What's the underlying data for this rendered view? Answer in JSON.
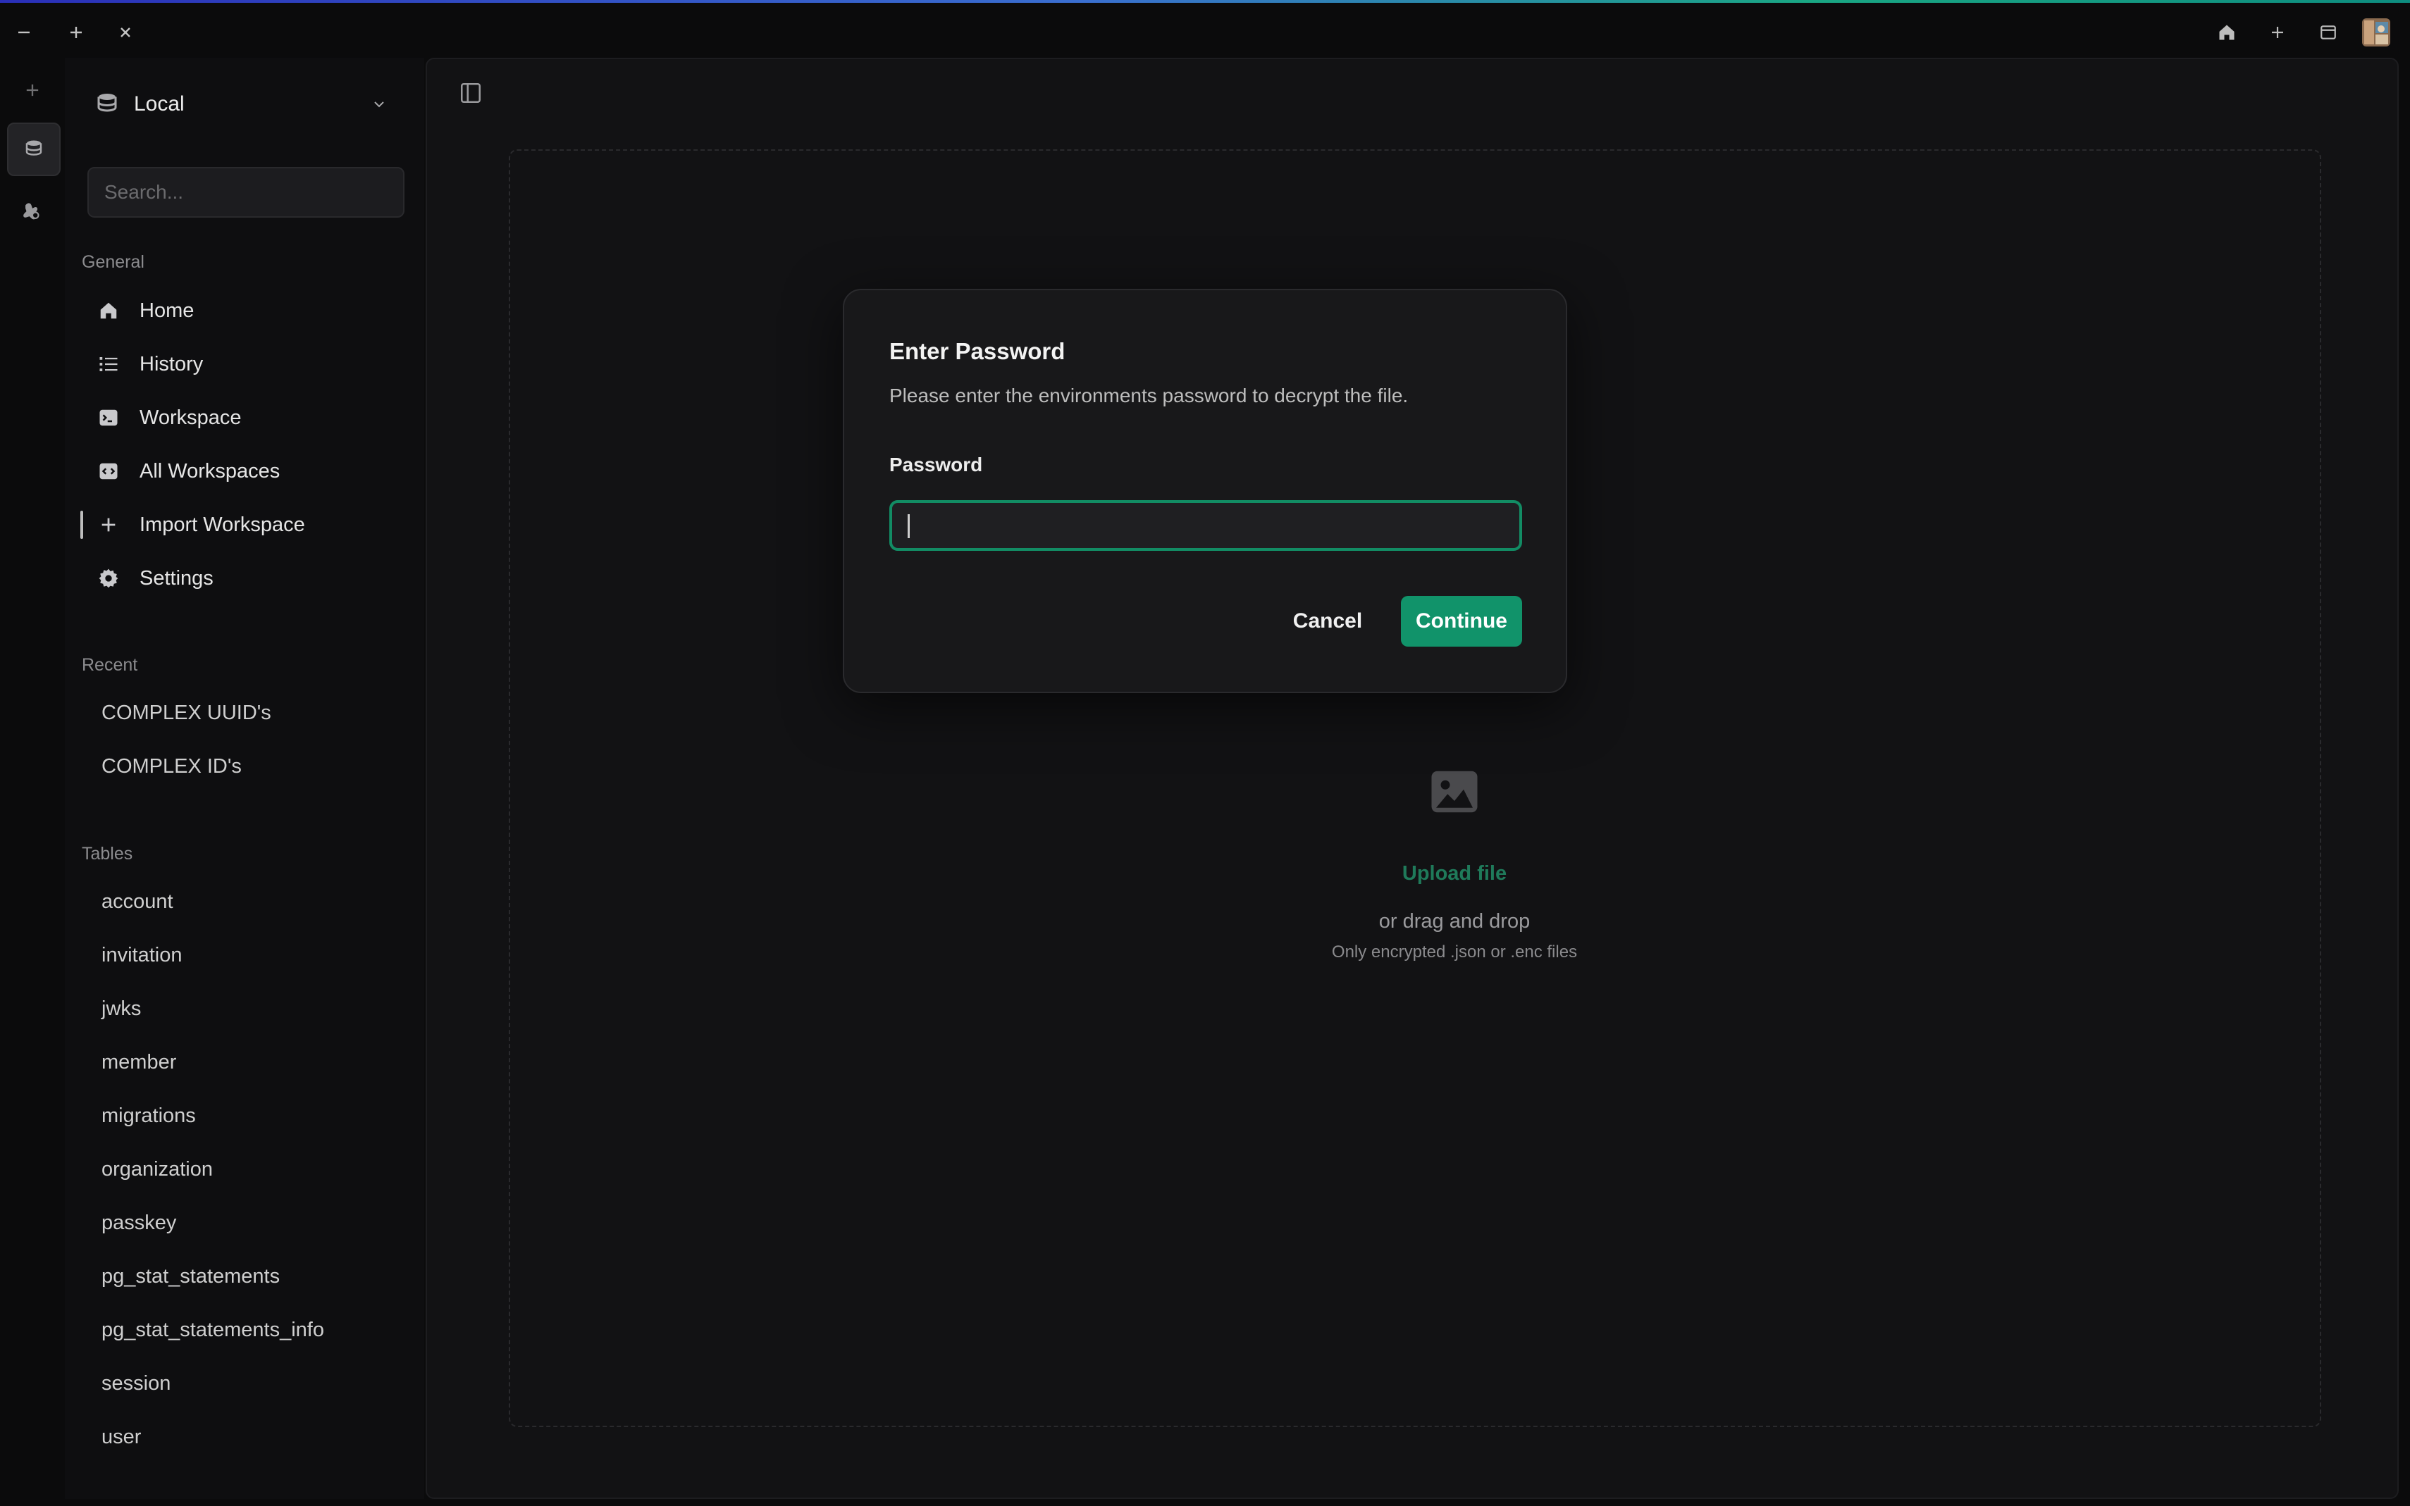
{
  "window": {
    "controls": [
      "minimize-icon",
      "add-icon",
      "close-icon"
    ],
    "right_controls": [
      "home-icon",
      "new-tab-icon",
      "window-icon",
      "avatar"
    ]
  },
  "rail": {
    "items": [
      "add-icon",
      "database-icon",
      "extension-icon"
    ]
  },
  "sidebar": {
    "db_select": {
      "label": "Local"
    },
    "search": {
      "placeholder": "Search..."
    },
    "general": {
      "title": "General",
      "items": [
        {
          "label": "Home",
          "icon": "home-icon"
        },
        {
          "label": "History",
          "icon": "list-icon"
        },
        {
          "label": "Workspace",
          "icon": "terminal-icon"
        },
        {
          "label": "All Workspaces",
          "icon": "code-icon"
        },
        {
          "label": "Import Workspace",
          "icon": "plus-icon"
        },
        {
          "label": "Settings",
          "icon": "gear-icon"
        }
      ]
    },
    "recent": {
      "title": "Recent",
      "items": [
        "COMPLEX UUID's",
        "COMPLEX ID's"
      ]
    },
    "tables": {
      "title": "Tables",
      "items": [
        "account",
        "invitation",
        "jwks",
        "member",
        "migrations",
        "organization",
        "passkey",
        "pg_stat_statements",
        "pg_stat_statements_info",
        "session",
        "user"
      ]
    }
  },
  "main": {
    "upload": {
      "link": "Upload file",
      "or_text": "or drag and drop",
      "hint": "Only encrypted .json or .enc files"
    }
  },
  "dialog": {
    "title": "Enter Password",
    "description": "Please enter the environments password to decrypt the file.",
    "password_label": "Password",
    "password_value": "",
    "cancel_label": "Cancel",
    "continue_label": "Continue"
  },
  "colors": {
    "accent": "#11936a",
    "accent_border": "#128c64",
    "link": "#1f7a5a",
    "background": "#0b0b0c"
  }
}
